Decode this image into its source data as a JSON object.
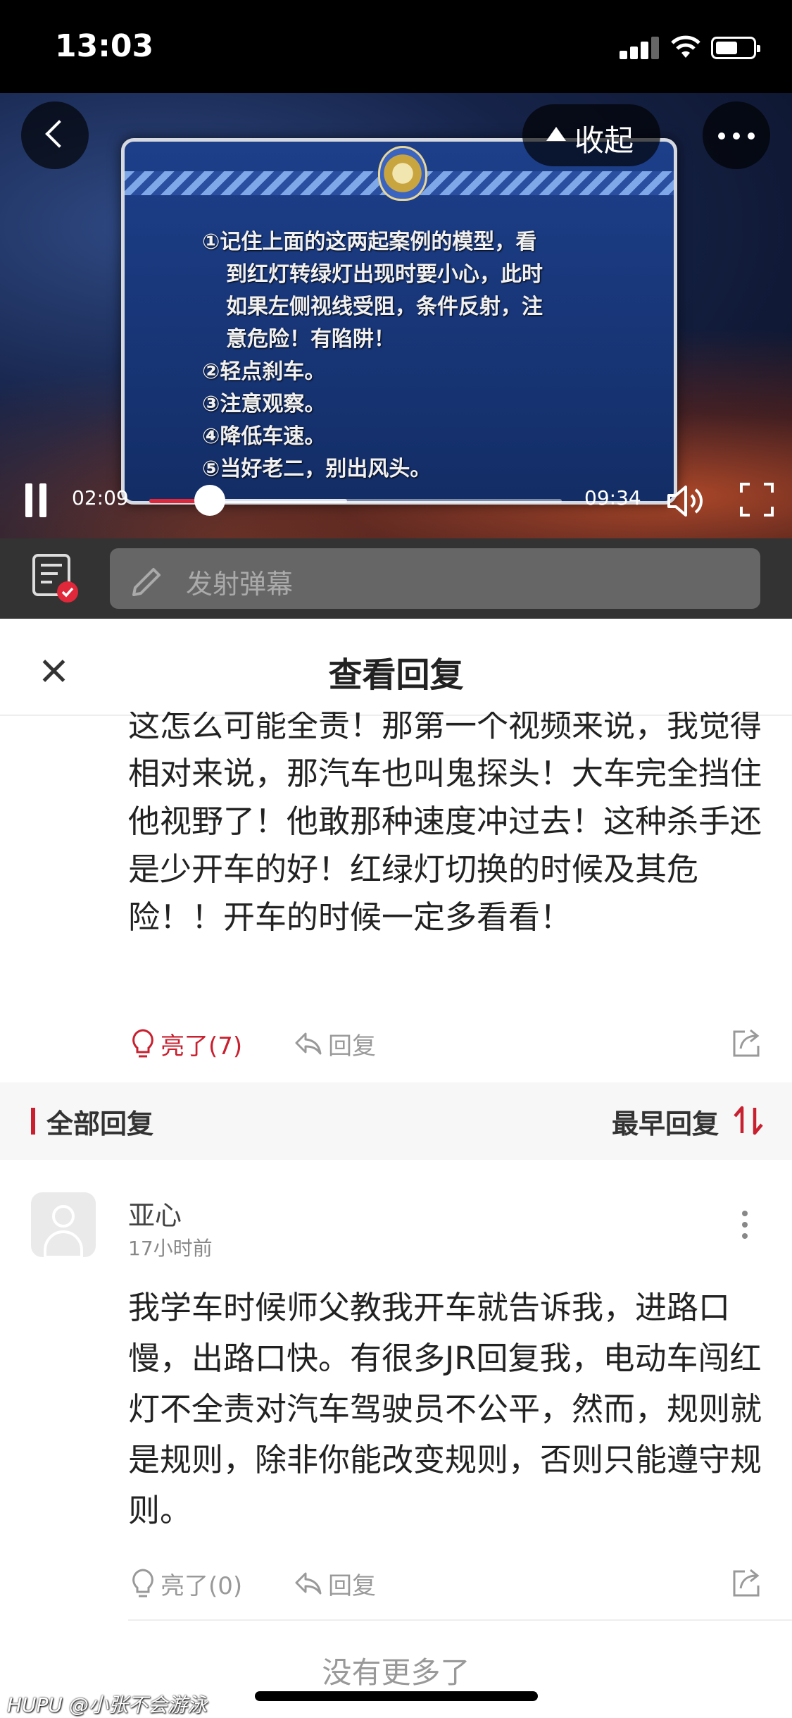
{
  "status_bar": {
    "time": "13:03"
  },
  "video": {
    "collapse_label": "收起",
    "panel_lines": [
      "①记住上面的这两起案例的模型，看",
      "到红灯转绿灯出现时要小心，此时",
      "如果左侧视线受阻，条件反射，注",
      "意危险！有陷阱！",
      "②轻点刹车。",
      "③注意观察。",
      "④降低车速。",
      "⑤当好老二，别出风头。"
    ],
    "current_time": "02:09",
    "duration": "09:34",
    "progress": 0.146,
    "buffered": 0.48
  },
  "danmaku": {
    "placeholder": "发射弹幕"
  },
  "reply_panel": {
    "title": "查看回复"
  },
  "original_post": {
    "text": "这怎么可能全责！那第一个视频来说，我觉得相对来说，那汽车也叫鬼探头！大车完全挡住他视野了！他敢那种速度冲过去！这种杀手还是少开车的好！红绿灯切换的时候及其危险！！开车的时候一定多看看！",
    "like_label": "亮了(7)",
    "reply_label": "回复"
  },
  "section": {
    "all_label": "全部回复",
    "sort_label": "最早回复"
  },
  "reply": {
    "username": "亚心",
    "time": "17小时前",
    "text": "我学车时候师父教我开车就告诉我，进路口慢，出路口快。有很多JR回复我，电动车闯红灯不全责对汽车驾驶员不公平，然而，规则就是规则，除非你能改变规则，否则只能遵守规则。",
    "like_label": "亮了(0)",
    "reply_label": "回复"
  },
  "footer": {
    "no_more": "没有更多了",
    "watermark": "HUPU @小张不会游泳"
  },
  "colors": {
    "accent": "#c8202f",
    "progress": "#e0283a"
  }
}
